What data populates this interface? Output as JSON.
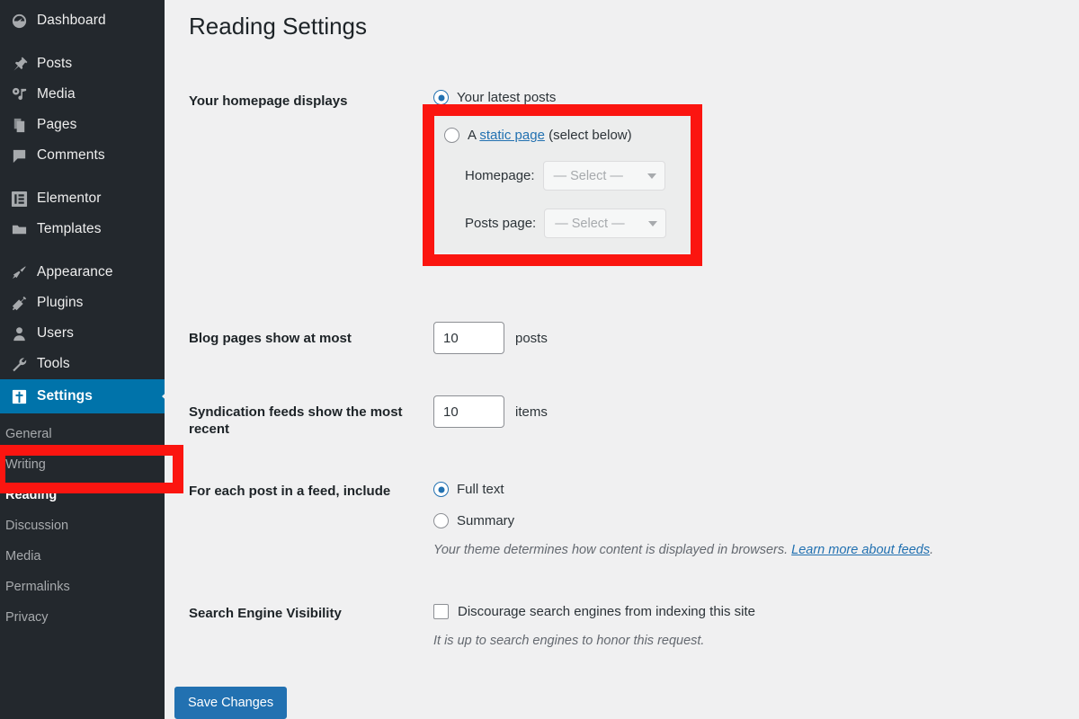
{
  "sidebar": {
    "items": [
      {
        "label": "Dashboard",
        "icon": "dashboard-icon",
        "name": "dashboard"
      },
      {
        "label": "Posts",
        "icon": "pin-icon",
        "name": "posts"
      },
      {
        "label": "Media",
        "icon": "media-icon",
        "name": "media"
      },
      {
        "label": "Pages",
        "icon": "pages-icon",
        "name": "pages"
      },
      {
        "label": "Comments",
        "icon": "comment-icon",
        "name": "comments"
      },
      {
        "label": "Elementor",
        "icon": "elementor-icon",
        "name": "elementor"
      },
      {
        "label": "Templates",
        "icon": "folder-icon",
        "name": "templates"
      },
      {
        "label": "Appearance",
        "icon": "paintbrush-icon",
        "name": "appearance"
      },
      {
        "label": "Plugins",
        "icon": "plug-icon",
        "name": "plugins"
      },
      {
        "label": "Users",
        "icon": "user-icon",
        "name": "users"
      },
      {
        "label": "Tools",
        "icon": "wrench-icon",
        "name": "tools"
      }
    ],
    "settings": {
      "label": "Settings",
      "icon": "settings-icon",
      "active": true
    },
    "submenu": [
      {
        "label": "General",
        "current": false
      },
      {
        "label": "Writing",
        "current": false
      },
      {
        "label": "Reading",
        "current": true
      },
      {
        "label": "Discussion",
        "current": false
      },
      {
        "label": "Media",
        "current": false
      },
      {
        "label": "Permalinks",
        "current": false
      },
      {
        "label": "Privacy",
        "current": false
      }
    ]
  },
  "main": {
    "page_title": "Reading Settings",
    "homepage_displays": {
      "label": "Your homepage displays",
      "option_latest": "Your latest posts",
      "option_static_prefix": "A ",
      "option_static_link": "static page",
      "option_static_suffix": " (select below)",
      "homepage_label": "Homepage:",
      "homepage_value": "— Select —",
      "posts_page_label": "Posts page:",
      "posts_page_value": "— Select —"
    },
    "blog_pages": {
      "label": "Blog pages show at most",
      "value": "10",
      "unit": "posts"
    },
    "syndication": {
      "label": "Syndication feeds show the most recent",
      "value": "10",
      "unit": "items"
    },
    "feed_include": {
      "label": "For each post in a feed, include",
      "option_full": "Full text",
      "option_summary": "Summary",
      "help_prefix": "Your theme determines how content is displayed in browsers. ",
      "help_link": "Learn more about feeds",
      "help_suffix": "."
    },
    "search_visibility": {
      "label": "Search Engine Visibility",
      "checkbox_label": "Discourage search engines from indexing this site",
      "help": "It is up to search engines to honor this request."
    },
    "save_label": "Save Changes"
  },
  "colors": {
    "sidebar_bg": "#23282d",
    "accent_blue": "#0073aa",
    "button_blue": "#2271b1",
    "highlight_red": "#fb1510",
    "content_bg": "#f0f0f1"
  }
}
